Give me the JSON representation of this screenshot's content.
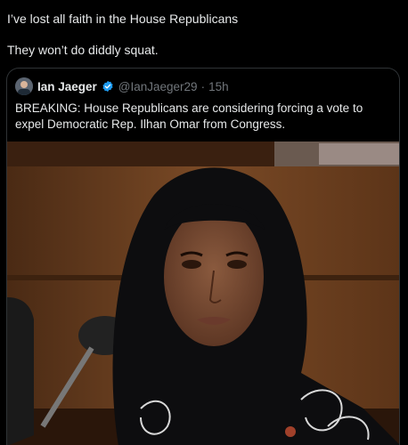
{
  "post": {
    "line1": "I’ve lost all faith in the House Republicans",
    "line2": "They won’t do diddly squat."
  },
  "quoted_post": {
    "author_name": "Ian Jaeger",
    "verified_icon": "verified-badge-icon",
    "handle": "@IanJaeger29",
    "separator": "·",
    "time": "15h",
    "text": "BREAKING: House Republicans are considering forcing a vote to expel Democratic Rep. Ilhan Omar from Congress.",
    "media": {
      "alt": "Photo of Rep. Ilhan Omar wearing a black headscarf in a wood-paneled hearing room"
    }
  },
  "colors": {
    "background": "#000000",
    "text": "#e7e9ea",
    "muted": "#71767b",
    "border": "#2f3336",
    "verified": "#1d9bf0"
  }
}
